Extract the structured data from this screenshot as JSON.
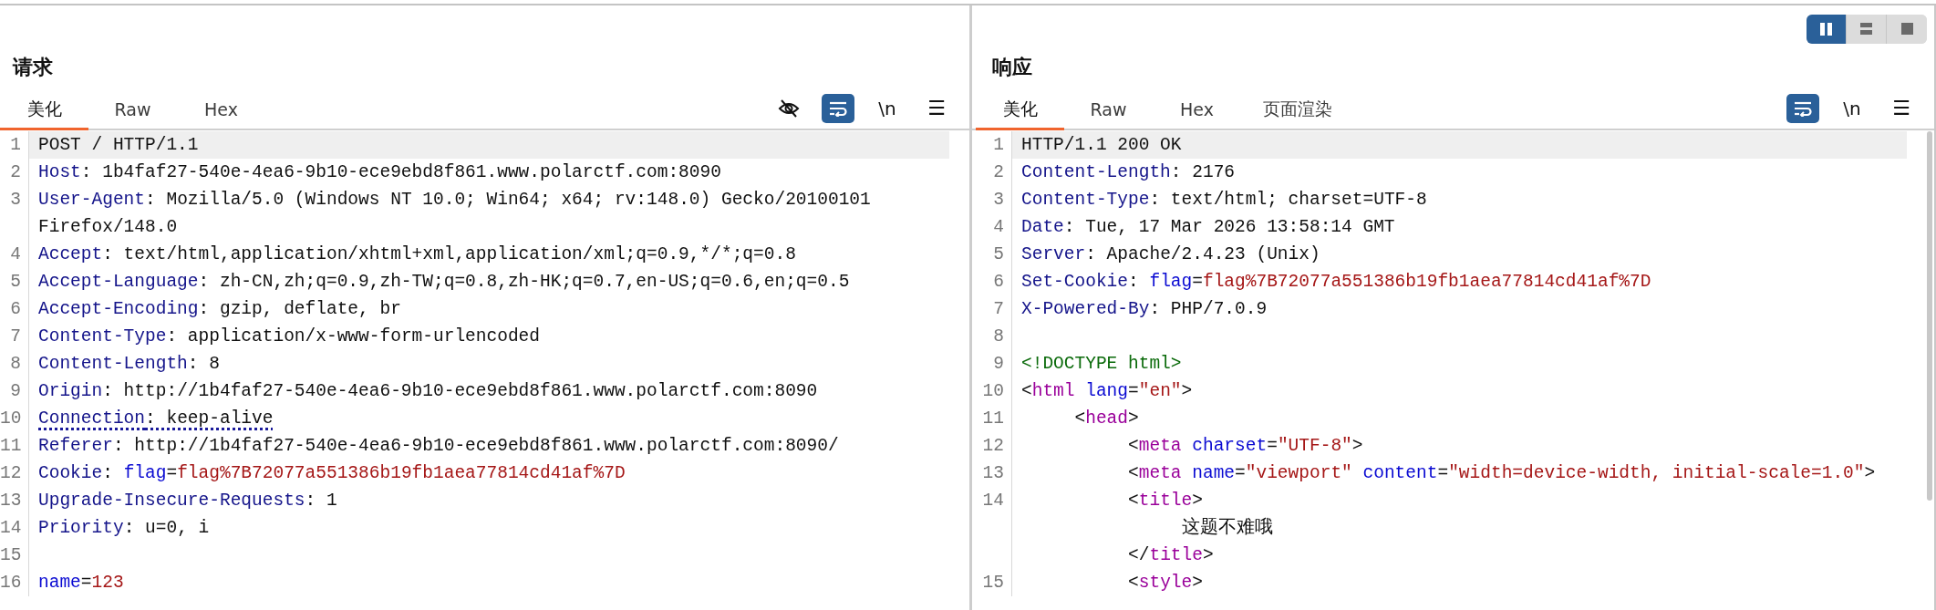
{
  "layout_toggles": [
    {
      "kind": "side-by-side",
      "selected": true
    },
    {
      "kind": "stacked",
      "selected": false
    },
    {
      "kind": "single",
      "selected": false
    }
  ],
  "request": {
    "title": "请求",
    "tabs": [
      {
        "label": "美化",
        "selected": true
      },
      {
        "label": "Raw",
        "selected": false
      },
      {
        "label": "Hex",
        "selected": false
      }
    ],
    "tools": [
      {
        "kind": "hide",
        "on": false
      },
      {
        "kind": "wrap",
        "on": true
      },
      {
        "kind": "newline",
        "label": "\\n",
        "on": false
      },
      {
        "kind": "menu",
        "label": "☰"
      }
    ],
    "lines": [
      {
        "number": "1",
        "current": true,
        "rows": [
          {
            "tokens": [
              {
                "kind": "text",
                "text": "POST / HTTP/1.1"
              }
            ]
          }
        ]
      },
      {
        "number": "2",
        "current": false,
        "rows": [
          {
            "tokens": [
              {
                "kind": "header",
                "text": "Host"
              },
              {
                "kind": "text",
                "text": ": 1b4faf27-540e-4ea6-9b10-ece9ebd8f861.www.polarctf.com:8090"
              }
            ]
          }
        ]
      },
      {
        "number": "3",
        "current": false,
        "rows": [
          {
            "tokens": [
              {
                "kind": "header",
                "text": "User-Agent"
              },
              {
                "kind": "text",
                "text": ": Mozilla/5.0 (Windows NT 10.0; Win64; x64; rv:148.0) Gecko/20100101"
              }
            ]
          },
          {
            "tokens": [
              {
                "kind": "text",
                "text": "Firefox/148.0"
              }
            ]
          }
        ]
      },
      {
        "number": "4",
        "current": false,
        "rows": [
          {
            "tokens": [
              {
                "kind": "header",
                "text": "Accept"
              },
              {
                "kind": "text",
                "text": ": text/html,application/xhtml+xml,application/xml;q=0.9,*/*;q=0.8"
              }
            ]
          }
        ]
      },
      {
        "number": "5",
        "current": false,
        "rows": [
          {
            "tokens": [
              {
                "kind": "header",
                "text": "Accept-Language"
              },
              {
                "kind": "text",
                "text": ": zh-CN,zh;q=0.9,zh-TW;q=0.8,zh-HK;q=0.7,en-US;q=0.6,en;q=0.5"
              }
            ]
          }
        ]
      },
      {
        "number": "6",
        "current": false,
        "rows": [
          {
            "tokens": [
              {
                "kind": "header",
                "text": "Accept-Encoding"
              },
              {
                "kind": "text",
                "text": ": gzip, deflate, br"
              }
            ]
          }
        ]
      },
      {
        "number": "7",
        "current": false,
        "rows": [
          {
            "tokens": [
              {
                "kind": "header",
                "text": "Content-Type"
              },
              {
                "kind": "text",
                "text": ": application/x-www-form-urlencoded"
              }
            ]
          }
        ]
      },
      {
        "number": "8",
        "current": false,
        "rows": [
          {
            "tokens": [
              {
                "kind": "header",
                "text": "Content-Length"
              },
              {
                "kind": "text",
                "text": ": 8"
              }
            ]
          }
        ]
      },
      {
        "number": "9",
        "current": false,
        "rows": [
          {
            "tokens": [
              {
                "kind": "header",
                "text": "Origin"
              },
              {
                "kind": "text",
                "text": ": http://1b4faf27-540e-4ea6-9b10-ece9ebd8f861.www.polarctf.com:8090"
              }
            ]
          }
        ]
      },
      {
        "number": "10",
        "current": false,
        "underlined": true,
        "rows": [
          {
            "tokens": [
              {
                "kind": "header",
                "text": "Connection"
              },
              {
                "kind": "text",
                "text": ": keep-alive"
              }
            ]
          }
        ]
      },
      {
        "number": "11",
        "current": false,
        "rows": [
          {
            "tokens": [
              {
                "kind": "header",
                "text": "Referer"
              },
              {
                "kind": "text",
                "text": ": http://1b4faf27-540e-4ea6-9b10-ece9ebd8f861.www.polarctf.com:8090/"
              }
            ]
          }
        ]
      },
      {
        "number": "12",
        "current": false,
        "rows": [
          {
            "tokens": [
              {
                "kind": "header",
                "text": "Cookie"
              },
              {
                "kind": "text",
                "text": ": "
              },
              {
                "kind": "param",
                "text": "flag"
              },
              {
                "kind": "text",
                "text": "="
              },
              {
                "kind": "value",
                "text": "flag%7B72077a551386b19fb1aea77814cd41af%7D"
              }
            ]
          }
        ]
      },
      {
        "number": "13",
        "current": false,
        "rows": [
          {
            "tokens": [
              {
                "kind": "header",
                "text": "Upgrade-Insecure-Requests"
              },
              {
                "kind": "text",
                "text": ": 1"
              }
            ]
          }
        ]
      },
      {
        "number": "14",
        "current": false,
        "rows": [
          {
            "tokens": [
              {
                "kind": "header",
                "text": "Priority"
              },
              {
                "kind": "text",
                "text": ": u=0, i"
              }
            ]
          }
        ]
      },
      {
        "number": "15"
      },
      {
        "number": "16",
        "current": false,
        "rows": [
          {
            "tokens": [
              {
                "kind": "param",
                "text": "name"
              },
              {
                "kind": "text",
                "text": "="
              },
              {
                "kind": "value",
                "text": "123"
              }
            ]
          }
        ]
      }
    ]
  },
  "response": {
    "title": "响应",
    "tabs": [
      {
        "label": "美化",
        "selected": true
      },
      {
        "label": "Raw",
        "selected": false
      },
      {
        "label": "Hex",
        "selected": false
      },
      {
        "label": "页面渲染",
        "selected": false
      }
    ],
    "tools": [
      {
        "kind": "wrap",
        "on": true
      },
      {
        "kind": "newline",
        "label": "\\n",
        "on": false
      },
      {
        "kind": "menu",
        "label": "☰"
      }
    ],
    "lines": [
      {
        "number": "1",
        "current": true,
        "rows": [
          {
            "tokens": [
              {
                "kind": "text",
                "text": "HTTP/1.1 200 OK"
              }
            ]
          }
        ]
      },
      {
        "number": "2",
        "current": false,
        "rows": [
          {
            "tokens": [
              {
                "kind": "header",
                "text": "Content-Length"
              },
              {
                "kind": "text",
                "text": ": 2176"
              }
            ]
          }
        ]
      },
      {
        "number": "3",
        "current": false,
        "rows": [
          {
            "tokens": [
              {
                "kind": "header",
                "text": "Content-Type"
              },
              {
                "kind": "text",
                "text": ": text/html; charset=UTF-8"
              }
            ]
          }
        ]
      },
      {
        "number": "4",
        "current": false,
        "rows": [
          {
            "tokens": [
              {
                "kind": "header",
                "text": "Date"
              },
              {
                "kind": "text",
                "text": ": Tue, 17 Mar 2026 13:58:14 GMT"
              }
            ]
          }
        ]
      },
      {
        "number": "5",
        "current": false,
        "rows": [
          {
            "tokens": [
              {
                "kind": "header",
                "text": "Server"
              },
              {
                "kind": "text",
                "text": ": Apache/2.4.23 (Unix)"
              }
            ]
          }
        ]
      },
      {
        "number": "6",
        "current": false,
        "rows": [
          {
            "tokens": [
              {
                "kind": "header",
                "text": "Set-Cookie"
              },
              {
                "kind": "text",
                "text": ": "
              },
              {
                "kind": "param",
                "text": "flag"
              },
              {
                "kind": "text",
                "text": "="
              },
              {
                "kind": "value",
                "text": "flag%7B72077a551386b19fb1aea77814cd41af%7D"
              }
            ]
          }
        ]
      },
      {
        "number": "7",
        "current": false,
        "rows": [
          {
            "tokens": [
              {
                "kind": "header",
                "text": "X-Powered-By"
              },
              {
                "kind": "text",
                "text": ": PHP/7.0.9"
              }
            ]
          }
        ]
      },
      {
        "number": "8"
      },
      {
        "number": "9",
        "current": false,
        "rows": [
          {
            "tokens": [
              {
                "kind": "doctype",
                "text": "<!DOCTYPE html>"
              }
            ]
          }
        ]
      },
      {
        "number": "10",
        "current": false,
        "rows": [
          {
            "tokens": [
              {
                "kind": "text",
                "text": "<"
              },
              {
                "kind": "tag",
                "text": "html"
              },
              {
                "kind": "param",
                "text": " lang"
              },
              {
                "kind": "text",
                "text": "="
              },
              {
                "kind": "value",
                "text": "\"en\""
              },
              {
                "kind": "text",
                "text": ">"
              }
            ]
          }
        ]
      },
      {
        "number": "11",
        "current": false,
        "rows": [
          {
            "tokens": [
              {
                "kind": "text",
                "text": "     <"
              },
              {
                "kind": "tag",
                "text": "head"
              },
              {
                "kind": "text",
                "text": ">"
              }
            ]
          }
        ]
      },
      {
        "number": "12",
        "current": false,
        "rows": [
          {
            "tokens": [
              {
                "kind": "text",
                "text": "          <"
              },
              {
                "kind": "tag",
                "text": "meta"
              },
              {
                "kind": "param",
                "text": " charset"
              },
              {
                "kind": "text",
                "text": "="
              },
              {
                "kind": "value",
                "text": "\"UTF-8\""
              },
              {
                "kind": "text",
                "text": ">"
              }
            ]
          }
        ]
      },
      {
        "number": "13",
        "current": false,
        "rows": [
          {
            "tokens": [
              {
                "kind": "text",
                "text": "          <"
              },
              {
                "kind": "tag",
                "text": "meta"
              },
              {
                "kind": "param",
                "text": " name"
              },
              {
                "kind": "text",
                "text": "="
              },
              {
                "kind": "value",
                "text": "\"viewport\""
              },
              {
                "kind": "param",
                "text": " content"
              },
              {
                "kind": "text",
                "text": "="
              },
              {
                "kind": "value",
                "text": "\"width=device-width, initial-scale=1.0\""
              },
              {
                "kind": "text",
                "text": ">"
              }
            ]
          }
        ]
      },
      {
        "number": "14",
        "current": false,
        "rows": [
          {
            "tokens": [
              {
                "kind": "text",
                "text": "          <"
              },
              {
                "kind": "tag",
                "text": "title"
              },
              {
                "kind": "text",
                "text": ">"
              }
            ]
          },
          {
            "tokens": [
              {
                "kind": "text",
                "text": "               这题不难哦"
              }
            ]
          },
          {
            "tokens": [
              {
                "kind": "text",
                "text": "          </"
              },
              {
                "kind": "tag",
                "text": "title"
              },
              {
                "kind": "text",
                "text": ">"
              }
            ]
          }
        ]
      },
      {
        "number": "15",
        "current": false,
        "rows": [
          {
            "tokens": [
              {
                "kind": "text",
                "text": "          <"
              },
              {
                "kind": "tag",
                "text": "style"
              },
              {
                "kind": "text",
                "text": ">"
              }
            ]
          }
        ]
      }
    ]
  }
}
